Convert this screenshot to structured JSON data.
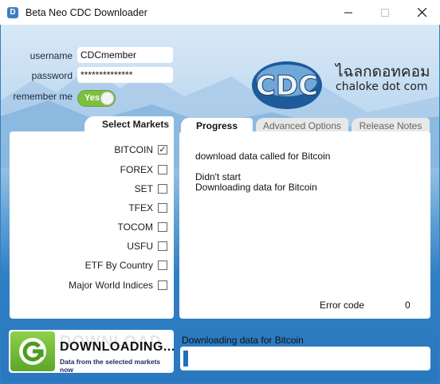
{
  "window": {
    "title": "Beta Neo CDC Downloader",
    "icon_letter": "D"
  },
  "login": {
    "username_label": "username",
    "username_value": "CDCmember",
    "password_label": "password",
    "password_value": "**************",
    "remember_label": "remember me",
    "remember_toggle_label": "Yes",
    "remember_on": true
  },
  "logo": {
    "thai_text": "ไฉลกดอทคอม",
    "sub_text": "chaloke dot com",
    "mark_text": "CDC"
  },
  "markets": {
    "header": "Select Markets",
    "items": [
      {
        "label": "BITCOIN",
        "checked": true,
        "check_glyph": "✓"
      },
      {
        "label": "FOREX",
        "checked": false,
        "check_glyph": ""
      },
      {
        "label": "SET",
        "checked": false,
        "check_glyph": ""
      },
      {
        "label": "TFEX",
        "checked": false,
        "check_glyph": ""
      },
      {
        "label": "TOCOM",
        "checked": false,
        "check_glyph": ""
      },
      {
        "label": "USFU",
        "checked": false,
        "check_glyph": ""
      },
      {
        "label": "ETF By Country",
        "checked": false,
        "check_glyph": ""
      },
      {
        "label": "Major World Indices",
        "checked": false,
        "check_glyph": ""
      }
    ]
  },
  "tabs": [
    {
      "label": "Progress",
      "active": true
    },
    {
      "label": "Advanced Options",
      "active": false
    },
    {
      "label": "Release Notes",
      "active": false
    }
  ],
  "progress_log": {
    "lines": [
      "download data called for Bitcoin",
      "",
      "Didn't start",
      "Downloading data for Bitcoin"
    ],
    "error_label": "Error code",
    "error_value": "0"
  },
  "download_button": {
    "ghost_text": "DOWNLOAD",
    "title": "DOWNLOADING...",
    "subtitle": "Data from the selected markets now"
  },
  "status": {
    "text": "Downloading data for Bitcoin",
    "progress_fraction": 0.02
  },
  "colors": {
    "accent": "#1e6fc0",
    "toggle_on": "#7fbf3f",
    "download_green": "#5da62a"
  }
}
